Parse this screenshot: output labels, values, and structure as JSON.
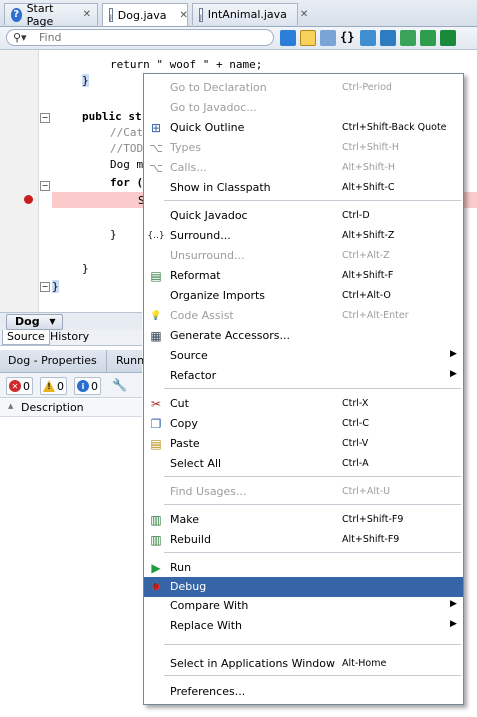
{
  "tabs": [
    {
      "label": "Start Page",
      "icon": "help-icon"
    },
    {
      "label": "Dog.java",
      "icon": "java-file-icon"
    },
    {
      "label": "IntAnimal.java",
      "icon": "java-file-icon"
    }
  ],
  "find": {
    "placeholder": "Find"
  },
  "code_lines": [
    "return \" woof \" + name;",
    "}",
    "public st",
    "//Cat",
    "//TOD",
    "Dog m",
    "for (",
    "S",
    "}",
    "}",
    "}"
  ],
  "navigator": {
    "crumb": "Dog",
    "source_tab": "Source",
    "history_tab": "History"
  },
  "properties": {
    "tab_title": "Dog - Properties",
    "tab_partial": "Runn",
    "errors": "0",
    "warnings": "0",
    "infos": "0",
    "column": "Description"
  },
  "menu": {
    "items": [
      {
        "label": "Go to Declaration",
        "shortcut": "Ctrl-Period",
        "disabled": true
      },
      {
        "label": "Go to Javadoc...",
        "shortcut": "",
        "disabled": true
      },
      {
        "label": "Quick Outline",
        "shortcut": "Ctrl+Shift-Back Quote",
        "disabled": false
      },
      {
        "label": "Types",
        "shortcut": "Ctrl+Shift-H",
        "disabled": true
      },
      {
        "label": "Calls...",
        "shortcut": "Alt+Shift-H",
        "disabled": true
      },
      {
        "label": "Show in Classpath",
        "shortcut": "Alt+Shift-C",
        "disabled": false
      },
      {
        "label": "Quick Javadoc",
        "shortcut": "Ctrl-D",
        "disabled": false
      },
      {
        "label": "Surround...",
        "shortcut": "Alt+Shift-Z",
        "disabled": false
      },
      {
        "label": "Unsurround...",
        "shortcut": "Ctrl+Alt-Z",
        "disabled": true
      },
      {
        "label": "Reformat",
        "shortcut": "Alt+Shift-F",
        "disabled": false
      },
      {
        "label": "Organize Imports",
        "shortcut": "Ctrl+Alt-O",
        "disabled": false
      },
      {
        "label": "Code Assist",
        "shortcut": "Ctrl+Alt-Enter",
        "disabled": true
      },
      {
        "label": "Generate Accessors...",
        "shortcut": "",
        "disabled": false
      },
      {
        "label": "Source",
        "shortcut": "",
        "disabled": false
      },
      {
        "label": "Refactor",
        "shortcut": "",
        "disabled": false
      },
      {
        "label": "Cut",
        "shortcut": "Ctrl-X",
        "disabled": false
      },
      {
        "label": "Copy",
        "shortcut": "Ctrl-C",
        "disabled": false
      },
      {
        "label": "Paste",
        "shortcut": "Ctrl-V",
        "disabled": false
      },
      {
        "label": "Select All",
        "shortcut": "Ctrl-A",
        "disabled": false
      },
      {
        "label": "Find Usages...",
        "shortcut": "Ctrl+Alt-U",
        "disabled": true
      },
      {
        "label": "Make",
        "shortcut": "Ctrl+Shift-F9",
        "disabled": false
      },
      {
        "label": "Rebuild",
        "shortcut": "Alt+Shift-F9",
        "disabled": false
      },
      {
        "label": "Run",
        "shortcut": "",
        "disabled": false
      },
      {
        "label": "Debug",
        "shortcut": "",
        "disabled": false
      },
      {
        "label": "Compare With",
        "shortcut": "",
        "disabled": false
      },
      {
        "label": "Replace With",
        "shortcut": "",
        "disabled": false
      },
      {
        "label": "Select in Applications Window",
        "shortcut": "Alt-Home",
        "disabled": false
      },
      {
        "label": "Preferences...",
        "shortcut": "",
        "disabled": false
      }
    ]
  },
  "colors": {
    "menu_highlight": "#3665a7",
    "breakpoint": "#c81e1e",
    "error_line": "#fbcaca"
  }
}
